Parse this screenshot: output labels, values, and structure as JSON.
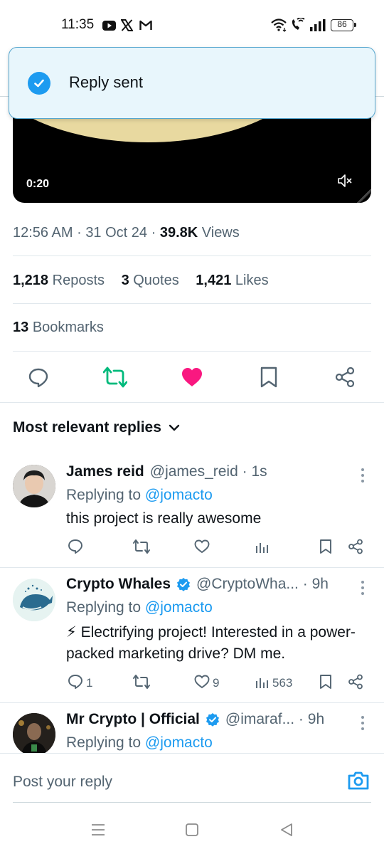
{
  "status_bar": {
    "time": "11:35",
    "battery": "86",
    "left_icons": [
      "youtube-icon",
      "x-logo-icon",
      "gmail-icon"
    ],
    "right_icons": [
      "wifi-icon",
      "wifi-calling-icon",
      "signal-icon",
      "battery-icon"
    ]
  },
  "toast": {
    "text": "Reply sent",
    "icon": "check-circle-icon"
  },
  "video": {
    "time": "0:20",
    "icon": "mute-icon"
  },
  "tweet_meta": {
    "time": "12:56 AM",
    "sep1": "·",
    "date": "31 Oct 24",
    "sep2": "·",
    "views_count": "39.8K",
    "views_label": "Views"
  },
  "stats": {
    "reposts_count": "1,218",
    "reposts_label": "Reposts",
    "quotes_count": "3",
    "quotes_label": "Quotes",
    "likes_count": "1,421",
    "likes_label": "Likes"
  },
  "bookmarks": {
    "count": "13",
    "label": "Bookmarks"
  },
  "actions": [
    "reply-icon",
    "repost-icon",
    "like-icon",
    "bookmark-icon",
    "share-icon"
  ],
  "colors": {
    "accent": "#1d9bf0",
    "repost_active": "#00ba7c",
    "like_active": "#f91880",
    "muted": "#536471",
    "toast_bg": "#e8f6fc"
  },
  "sort": {
    "label": "Most relevant replies"
  },
  "replies": [
    {
      "name": "James reid",
      "handle": "@james_reid",
      "dot": "·",
      "time": "1s",
      "replying_prefix": "Replying to",
      "replying_handle": "@jomacto",
      "text": "this project is really awesome",
      "reply_count": "",
      "like_count": "",
      "view_count": ""
    },
    {
      "name": "Crypto Whales",
      "verified": true,
      "handle": "@CryptoWha...",
      "dot": "·",
      "time": "9h",
      "replying_prefix": "Replying to",
      "replying_handle": "@jomacto",
      "text": "⚡ Electrifying project! Interested in a power-packed marketing drive? DM me.",
      "reply_count": "1",
      "like_count": "9",
      "view_count": "563"
    },
    {
      "name": "Mr Crypto | Official",
      "verified": true,
      "handle": "@imaraf...",
      "dot": "·",
      "time": "9h",
      "replying_prefix": "Replying to",
      "replying_handle": "@jomacto"
    }
  ],
  "composer": {
    "placeholder": "Post your reply",
    "icon": "camera-icon"
  },
  "navbar": [
    "menu-icon",
    "home-square-icon",
    "back-triangle-icon"
  ]
}
